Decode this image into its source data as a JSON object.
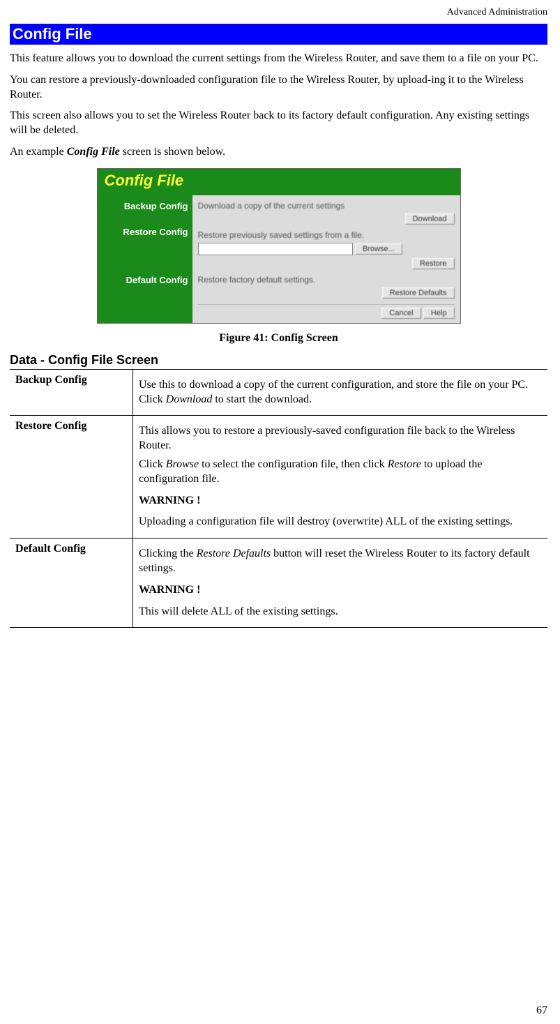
{
  "header_right": "Advanced Administration",
  "section_title": "Config File",
  "intro": {
    "p1": "This feature allows you to download the current settings from the Wireless Router, and save them to a file on your PC.",
    "p2": "You can restore a previously-downloaded configuration file to the Wireless Router, by upload-ing it to the Wireless Router.",
    "p3": "This screen also allows you to set the Wireless Router back to its factory default configuration. Any existing settings will be deleted.",
    "p4_prefix": "An example ",
    "p4_emph": "Config File",
    "p4_suffix": " screen is shown below."
  },
  "screenshot": {
    "title": "Config File",
    "side": {
      "backup": "Backup Config",
      "restore": "Restore Config",
      "default": "Default Config"
    },
    "main": {
      "backup_text": "Download a copy of the current settings",
      "download_btn": "Download",
      "restore_text": "Restore previously saved settings from a file.",
      "browse_btn": "Browse...",
      "restore_btn": "Restore",
      "default_text": "Restore factory default settings.",
      "defaults_btn": "Restore Defaults",
      "cancel_btn": "Cancel",
      "help_btn": "Help"
    }
  },
  "figure_caption": "Figure 41: Config Screen",
  "subheading": "Data - Config File Screen",
  "table": {
    "row1": {
      "label": "Backup Config",
      "p1a": "Use this to download a copy of the current configuration, and store the file on your PC. Click ",
      "p1i": "Download",
      "p1b": " to start the download."
    },
    "row2": {
      "label": "Restore Config",
      "p1": "This allows you to restore a previously-saved configuration file back to the Wireless Router.",
      "p2a": "Click ",
      "p2i1": "Browse",
      "p2b": " to select the configuration file, then click ",
      "p2i2": "Restore",
      "p2c": " to upload the configuration file.",
      "warn": "WARNING !",
      "p3": "Uploading a configuration file will destroy (overwrite) ALL of the existing settings."
    },
    "row3": {
      "label": "Default Config",
      "p1a": "Clicking the ",
      "p1i": "Restore Defaults",
      "p1b": " button will reset the Wireless Router to its factory default settings.",
      "warn": "WARNING !",
      "p2": "This will delete ALL of the existing settings."
    }
  },
  "page_number": "67"
}
